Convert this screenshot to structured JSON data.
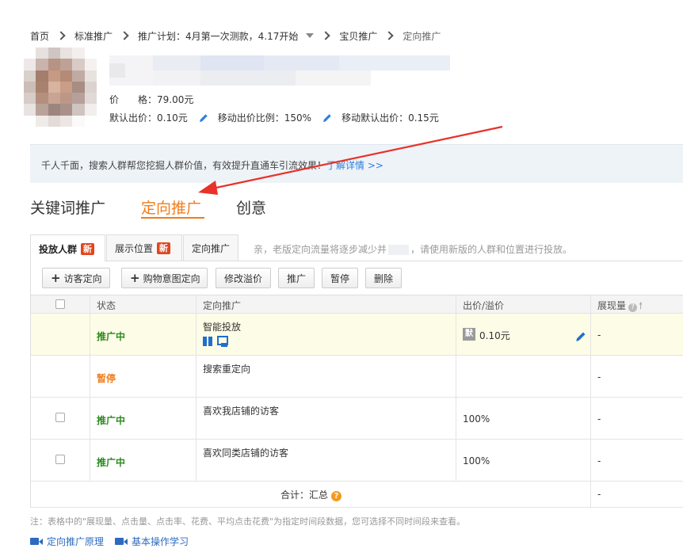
{
  "breadcrumb": {
    "home": "首页",
    "standard": "标准推广",
    "plan_label": "推广计划：",
    "plan_name": "4月第一次测款，4.17开始",
    "item": "宝贝推广",
    "current": "定向推广"
  },
  "product": {
    "price_label": "价　　格：",
    "price_value": "79.00元",
    "default_bid_label": "默认出价：",
    "default_bid_value": "0.10元",
    "mobile_ratio_label": "移动出价比例：",
    "mobile_ratio_value": "150%",
    "mobile_default_label": "移动默认出价：",
    "mobile_default_value": "0.15元"
  },
  "notice": {
    "text": "千人千面，搜索人群帮您挖掘人群价值，有效提升直通车引流效果！",
    "link": "了解详情 >>"
  },
  "main_tabs": [
    "关键词推广",
    "定向推广",
    "创意"
  ],
  "sub_tabs": {
    "audience": "投放人群",
    "audience_badge": "新",
    "placement": "展示位置",
    "placement_badge": "新",
    "targeting": "定向推广",
    "hint": "亲，老版定向流量将逐步减少并",
    "hint_tail": "，请使用新版的人群和位置进行投放。"
  },
  "toolbar": {
    "visitor": "访客定向",
    "purchase": "购物意图定向",
    "edit_premium": "修改溢价",
    "promote": "推广",
    "pause": "暂停",
    "delete": "删除"
  },
  "table": {
    "headers": {
      "status": "状态",
      "targeting": "定向推广",
      "bid": "出价/溢价",
      "impressions": "展现量"
    },
    "rows": [
      {
        "status": "推广中",
        "name": "智能投放",
        "bid": "0.10元",
        "impressions": "-"
      },
      {
        "status": "暂停",
        "name": "搜索重定向",
        "bid": "",
        "impressions": "-"
      },
      {
        "status": "推广中",
        "name": "喜欢我店铺的访客",
        "bid": "100%",
        "impressions": "-"
      },
      {
        "status": "推广中",
        "name": "喜欢同类店铺的访客",
        "bid": "100%",
        "impressions": "-"
      }
    ],
    "summary_label": "合计：汇总",
    "summary_value": "-"
  },
  "footer": {
    "note": "注：表格中的\"展现量、点击量、点击率、花费、平均点击花费\"为指定时间段数据，您可选择不同时间段来查看。",
    "link1": "定向推广原理",
    "link2": "基本操作学习"
  },
  "colors": {
    "accent": "#f07c1a",
    "link": "#2d7fe0",
    "active": "#2b8a1f",
    "badge": "#e2461f",
    "arrow": "#e8322a"
  }
}
